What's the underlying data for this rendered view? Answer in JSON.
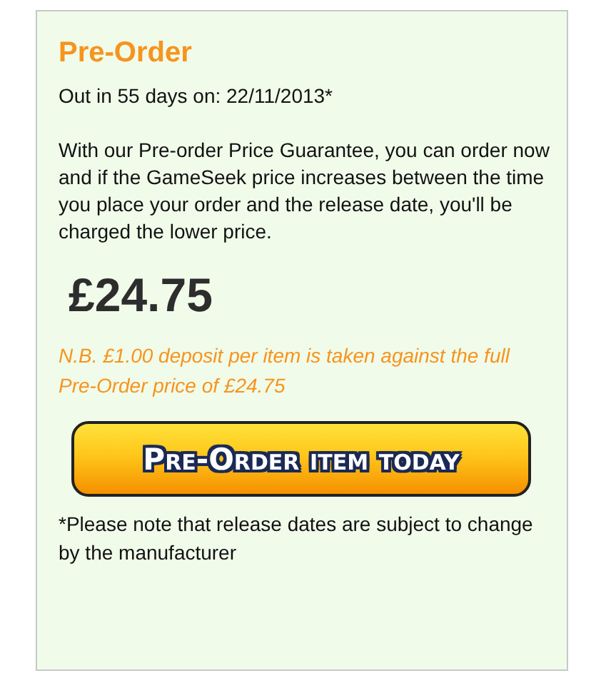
{
  "panel": {
    "title": "Pre-Order",
    "release": "Out in 55 days on: 22/11/2013*",
    "guarantee": "With our Pre-order Price Guarantee, you can order now and if the GameSeek price increases between the time you place your order and the release date, you'll be charged the lower price.",
    "price": "£24.75",
    "deposit_note": "N.B. £1.00 deposit per item is taken against the full Pre-Order price of £24.75",
    "button": "Pre-Order item today",
    "footnote": "*Please note that release dates are subject to change by the manufacturer"
  }
}
